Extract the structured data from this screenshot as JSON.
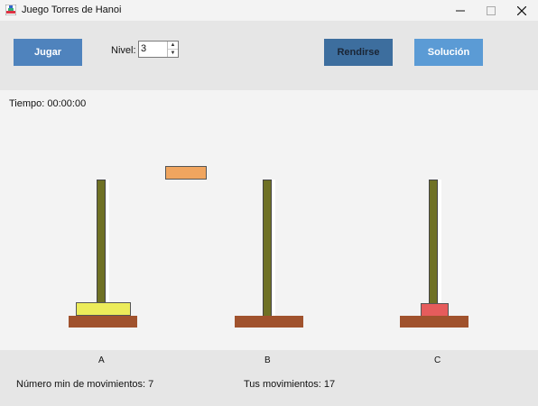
{
  "window": {
    "title": "Juego Torres de Hanoi",
    "minimize_icon": "minimize-icon",
    "maximize_icon": "maximize-icon",
    "close_icon": "close-icon"
  },
  "toolbar": {
    "play_label": "Jugar",
    "level_label": "Nivel:",
    "level_value": "3",
    "give_up_label": "Rendirse",
    "solution_label": "Solución"
  },
  "timer": {
    "text": "Tiempo: 00:00:00"
  },
  "pegs": [
    {
      "label": "A",
      "disks": [
        {
          "color": "#ecec5a"
        }
      ]
    },
    {
      "label": "B",
      "disks": []
    },
    {
      "label": "C",
      "disks": [
        {
          "color": "#e65c5c"
        }
      ]
    }
  ],
  "held_disk": {
    "color": "#f0a55f"
  },
  "colors": {
    "peg": "#6f7125",
    "base": "#a0522d",
    "primary_button": "#4f83bd",
    "give_up_button": "#3d6e9e",
    "solution_button": "#5b9bd5"
  },
  "stats": {
    "min_moves": "Número min de movimientos: 7",
    "your_moves": "Tus movimientos: 17"
  }
}
